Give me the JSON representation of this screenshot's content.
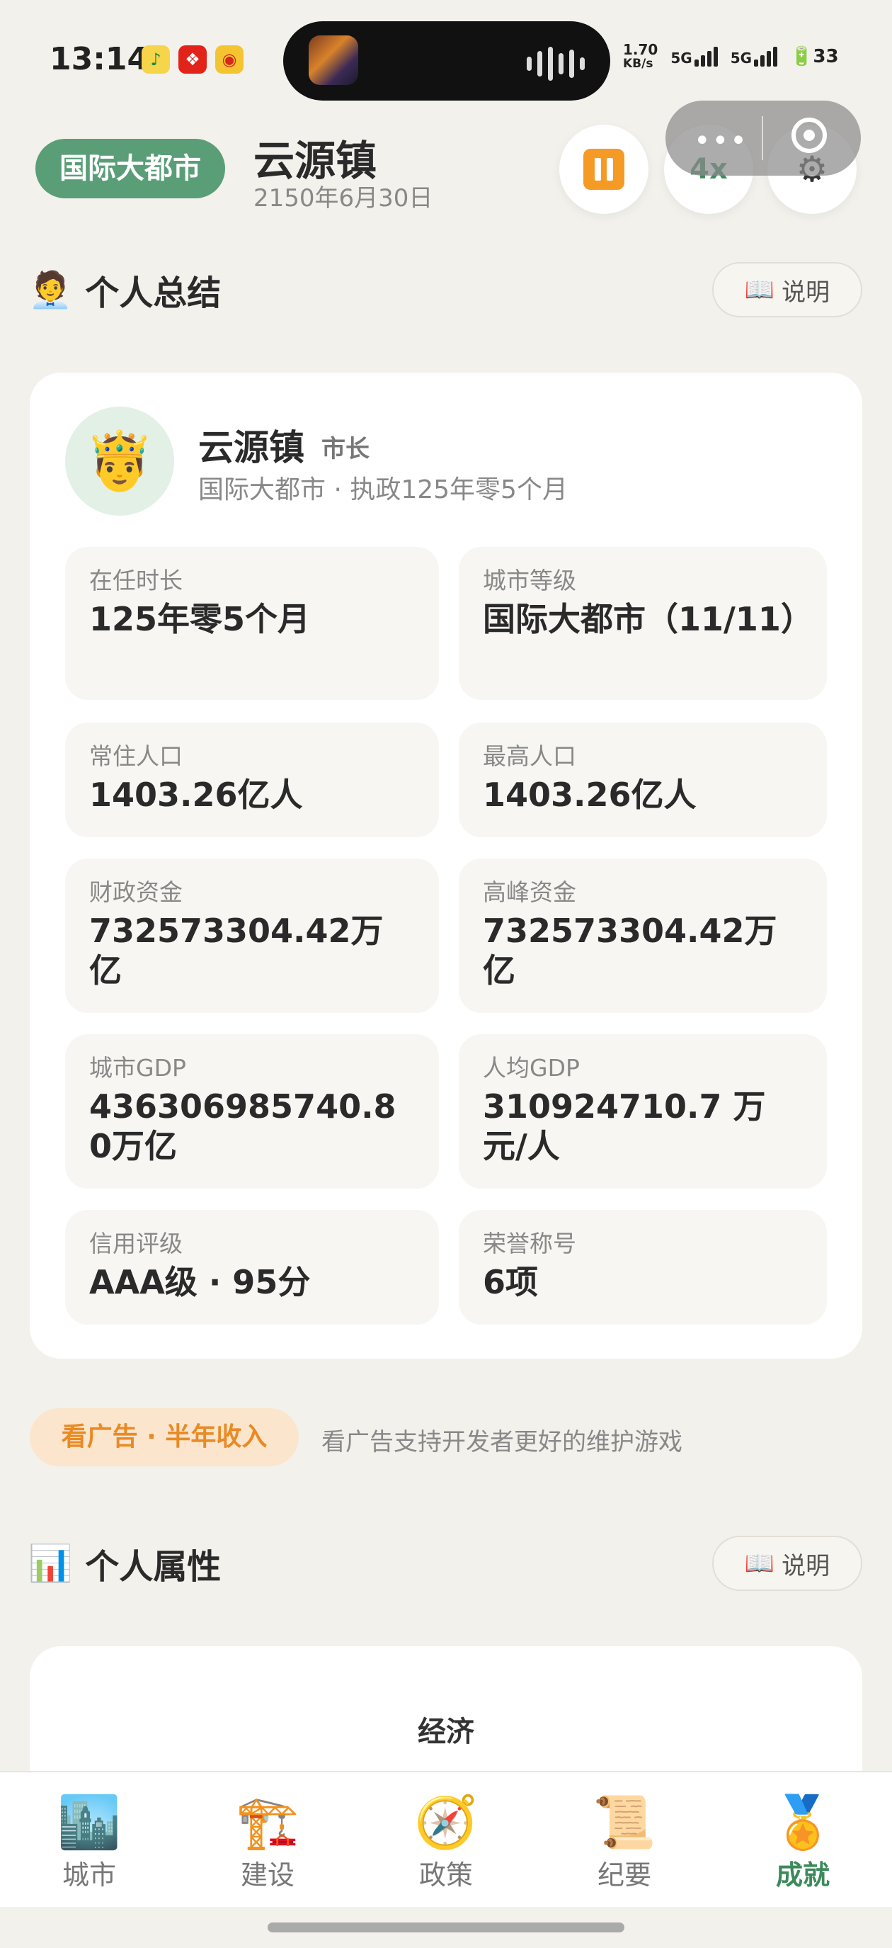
{
  "status_bar": {
    "time": "13:14",
    "net_speed_value": "1.70",
    "net_speed_unit": "KB/s",
    "signal1": "5G",
    "signal2": "5G",
    "battery": "33"
  },
  "header": {
    "level_badge": "国际大都市",
    "town_name": "云源镇",
    "date": "2150年6月30日",
    "speed_label": "4x"
  },
  "summary_section": {
    "emoji": "🧑‍💼",
    "title": "个人总结",
    "help_label": "说明",
    "help_icon": "📖"
  },
  "profile": {
    "avatar": "🤴",
    "name": "云源镇",
    "role": "市长",
    "description": "国际大都市 · 执政125年零5个月"
  },
  "stats": [
    {
      "label": "在任时长",
      "value": "125年零5个月"
    },
    {
      "label": "城市等级",
      "value": "国际大都市（11/11）"
    },
    {
      "label": "常住人口",
      "value": "1403.26亿人"
    },
    {
      "label": "最高人口",
      "value": "1403.26亿人"
    },
    {
      "label": "财政资金",
      "value": "732573304.42万亿"
    },
    {
      "label": "高峰资金",
      "value": "732573304.42万亿"
    },
    {
      "label": "城市GDP",
      "value": "436306985740.80万亿"
    },
    {
      "label": "人均GDP",
      "value": "310924710.7 万元/人"
    },
    {
      "label": "信用评级",
      "value": "AAA级 · 95分"
    },
    {
      "label": "荣誉称号",
      "value": "6项"
    }
  ],
  "ad": {
    "button_label": "看广告 · 半年收入",
    "description": "看广告支持开发者更好的维护游戏"
  },
  "attributes_section": {
    "emoji": "📊",
    "title": "个人属性",
    "help_label": "说明",
    "help_icon": "📖",
    "card_title": "经济"
  },
  "tabs": [
    {
      "icon": "🏙️",
      "label": "城市",
      "active": false
    },
    {
      "icon": "🏗️",
      "label": "建设",
      "active": false
    },
    {
      "icon": "🧭",
      "label": "政策",
      "active": false
    },
    {
      "icon": "📜",
      "label": "纪要",
      "active": false
    },
    {
      "icon": "🏅",
      "label": "成就",
      "active": true
    }
  ],
  "colors": {
    "accent_green": "#5a9e78",
    "accent_orange": "#f59a25",
    "background": "#f3f1ec"
  }
}
